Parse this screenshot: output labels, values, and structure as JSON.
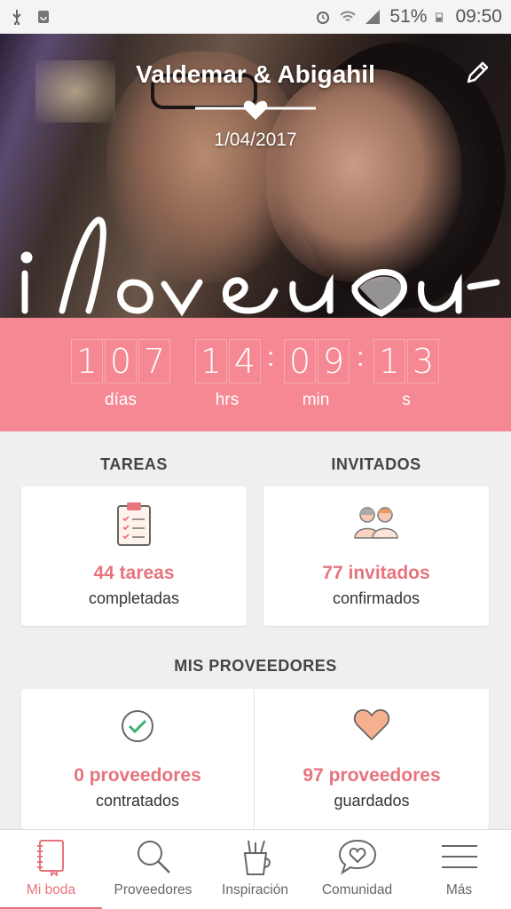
{
  "status_bar": {
    "battery": "51%",
    "time": "09:50"
  },
  "hero": {
    "title": "Valdemar & Abigahil",
    "date": "1/04/2017"
  },
  "countdown": {
    "days": [
      "1",
      "0",
      "7"
    ],
    "hours": [
      "1",
      "4"
    ],
    "minutes": [
      "0",
      "9"
    ],
    "seconds": [
      "1",
      "3"
    ],
    "labels": {
      "days": "días",
      "hours": "hrs",
      "minutes": "min",
      "seconds": "s"
    }
  },
  "tasks": {
    "title": "TAREAS",
    "count": "44 tareas",
    "status": "completadas"
  },
  "guests": {
    "title": "INVITADOS",
    "count": "77 invitados",
    "status": "confirmados"
  },
  "vendors": {
    "title": "MIS PROVEEDORES",
    "hired_count": "0 proveedores",
    "hired_status": "contratados",
    "saved_count": "97 proveedores",
    "saved_status": "guardados"
  },
  "nav": {
    "items": [
      {
        "label": "Mi boda",
        "icon": "notebook-icon",
        "active": true
      },
      {
        "label": "Proveedores",
        "icon": "search-icon",
        "active": false
      },
      {
        "label": "Inspiración",
        "icon": "pencil-cup-icon",
        "active": false
      },
      {
        "label": "Comunidad",
        "icon": "chat-heart-icon",
        "active": false
      },
      {
        "label": "Más",
        "icon": "menu-icon",
        "active": false
      }
    ]
  },
  "colors": {
    "accent": "#e6747d",
    "countdown_bg": "#f58892"
  }
}
